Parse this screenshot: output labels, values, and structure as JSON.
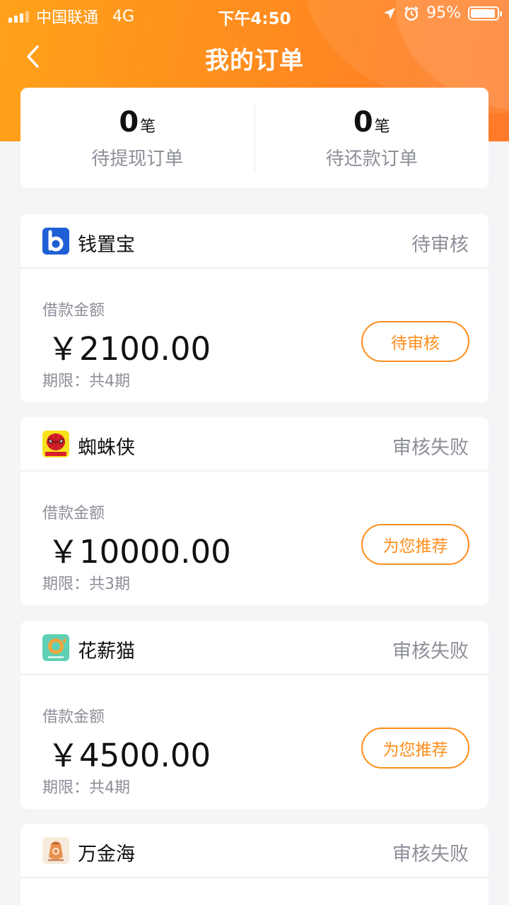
{
  "status_bar": {
    "carrier": "中国联通",
    "network": "4G",
    "time": "下午4:50",
    "battery_text": "95%",
    "battery_level": 0.95
  },
  "nav": {
    "title": "我的订单",
    "back_icon": "chevron-left-icon"
  },
  "summary": {
    "withdraw": {
      "count": "0",
      "unit": "笔",
      "label": "待提现订单"
    },
    "repay": {
      "count": "0",
      "unit": "笔",
      "label": "待还款订单"
    }
  },
  "orders": [
    {
      "app_name": "钱置宝",
      "status": "待审核",
      "amount_label": "借款金额",
      "amount": "￥2100.00",
      "term": "期限：共4期",
      "button": "待审核"
    },
    {
      "app_name": "蜘蛛侠",
      "status": "审核失败",
      "amount_label": "借款金额",
      "amount": "￥10000.00",
      "term": "期限：共3期",
      "button": "为您推荐"
    },
    {
      "app_name": "花薪猫",
      "status": "审核失败",
      "amount_label": "借款金额",
      "amount": "￥4500.00",
      "term": "期限：共4期",
      "button": "为您推荐"
    },
    {
      "app_name": "万金海",
      "status": "审核失败"
    }
  ],
  "colors": {
    "accent": "#ff8c1a",
    "header_gradient_start": "#ffa21a",
    "header_gradient_end": "#ff7a2a",
    "muted_text": "#8d8f99",
    "page_background": "#f4f5f7"
  }
}
